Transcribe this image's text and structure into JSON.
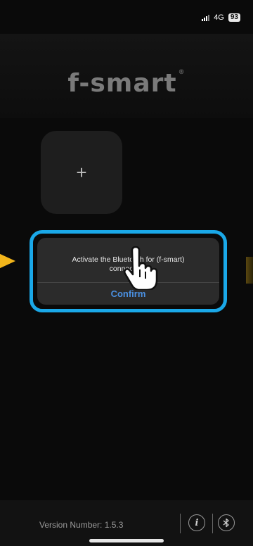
{
  "status_bar": {
    "network": "4G",
    "battery": "93"
  },
  "app": {
    "logo_text": "f-smart",
    "trademark": "®"
  },
  "main": {
    "add_tile_icon": "plus-icon",
    "add_tile_symbol": "+"
  },
  "dialog": {
    "message": "Activate the Bluetooth for (f-smart) connection.",
    "confirm_label": "Confirm"
  },
  "footer": {
    "version_text": "Version Number: 1.5.3",
    "info_icon": "info-icon",
    "bluetooth_icon": "bluetooth-icon"
  },
  "colors": {
    "highlight": "#1aa8e8",
    "confirm_text": "#4a90e2",
    "pointer_arrow": "#f2b51b"
  }
}
